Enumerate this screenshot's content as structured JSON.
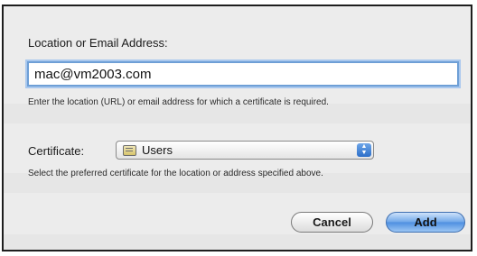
{
  "dialog": {
    "location_label": "Location or Email Address:",
    "email_value": "mac@vm2003.com",
    "location_help": "Enter the location (URL) or email address for which a certificate is required.",
    "certificate_label": "Certificate:",
    "certificate_selected": "Users",
    "certificate_help": "Select the preferred certificate for the location or address specified above.",
    "cancel_label": "Cancel",
    "add_label": "Add"
  },
  "icons": {
    "certificate": "certificate-icon",
    "stepper": "popup-stepper-icon"
  },
  "colors": {
    "focus_ring": "#6e9fd6",
    "primary_button": "#4d8ee0"
  }
}
